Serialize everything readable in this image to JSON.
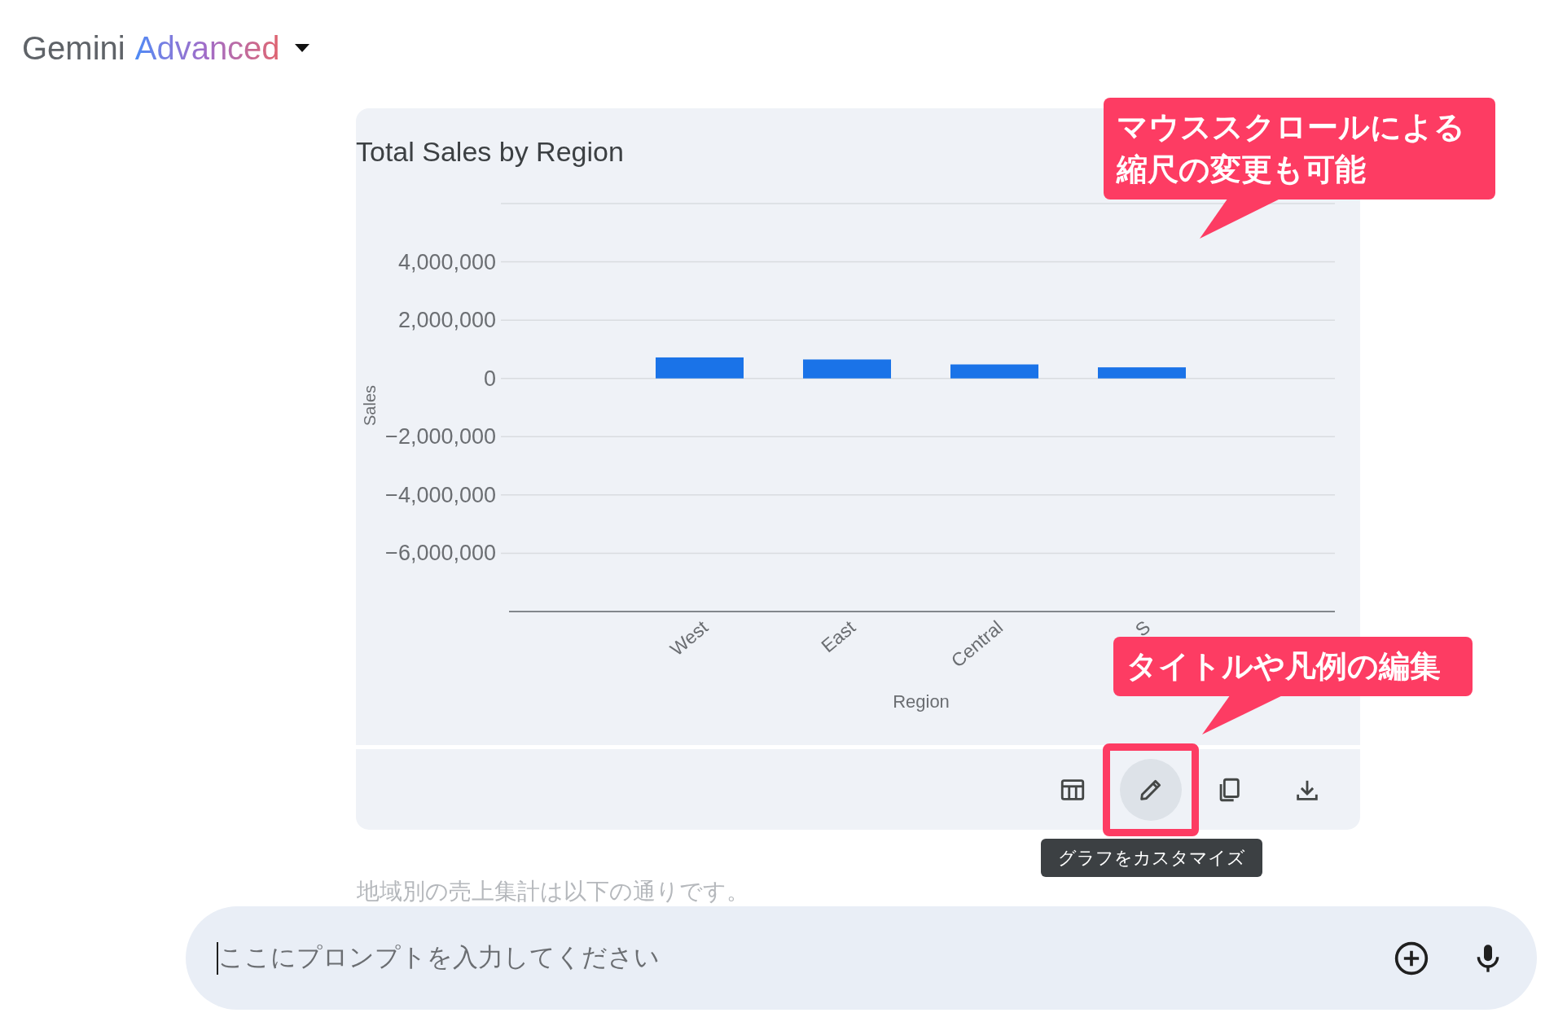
{
  "header": {
    "title": "Gemini",
    "title_accent": "Advanced"
  },
  "chart_card": {
    "title": "Total Sales by Region",
    "chart_data": {
      "type": "bar",
      "xlabel": "Region",
      "ylabel": "Sales",
      "categories": [
        "West",
        "East",
        "Central",
        "S"
      ],
      "values": [
        720000,
        650000,
        480000,
        380000
      ],
      "grid": true,
      "ylim": [
        -8000000,
        6000000
      ],
      "yticks": [
        {
          "value": 4000000,
          "label": "4,000,000"
        },
        {
          "value": 2000000,
          "label": "2,000,000"
        },
        {
          "value": 0,
          "label": "0"
        },
        {
          "value": -2000000,
          "label": "−2,000,000"
        },
        {
          "value": -4000000,
          "label": "−4,000,000"
        },
        {
          "value": -6000000,
          "label": "−6,000,000"
        }
      ]
    },
    "toolbar": [
      {
        "kind": "table",
        "selected": false,
        "annotated": false
      },
      {
        "kind": "edit",
        "selected": true,
        "annotated": true
      },
      {
        "kind": "copy",
        "selected": false,
        "annotated": false
      },
      {
        "kind": "download",
        "selected": false,
        "annotated": false
      }
    ],
    "tooltip": "グラフをカスタマイズ"
  },
  "callouts": [
    {
      "lines": [
        "マウススクロールによる",
        "縮尺の変更も可能"
      ]
    },
    {
      "lines": [
        "タイトルや凡例の編集"
      ]
    }
  ],
  "message": "地域別の売上集計は以下の通りです。",
  "prompt": {
    "placeholder": "ここにプロンプトを入力してください"
  }
}
